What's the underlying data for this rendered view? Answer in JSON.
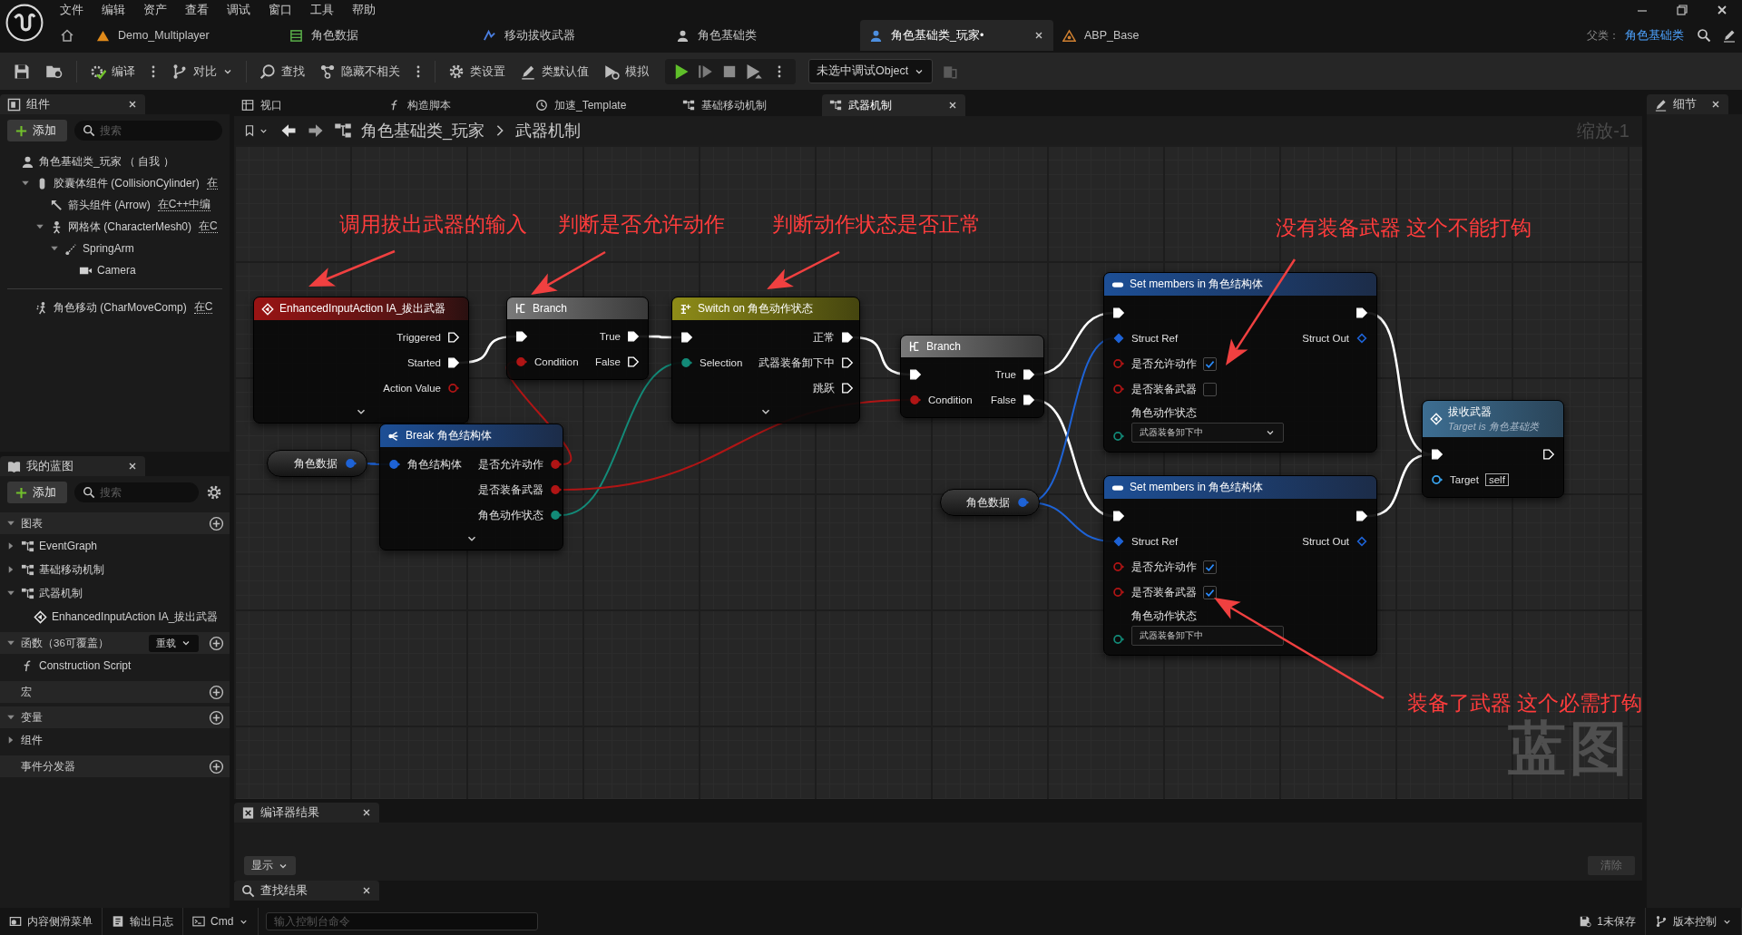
{
  "menu": [
    "文件",
    "编辑",
    "资产",
    "查看",
    "调试",
    "窗口",
    "工具",
    "帮助"
  ],
  "doc_tabs": [
    {
      "label": "Demo_Multiplayer",
      "selected": false
    },
    {
      "label": "角色数据",
      "selected": false
    },
    {
      "label": "移动拔收武器",
      "selected": false
    },
    {
      "label": "角色基础类",
      "selected": false
    },
    {
      "label": "角色基础类_玩家•",
      "selected": true
    },
    {
      "label": "ABP_Base",
      "selected": false
    }
  ],
  "parent_class": {
    "label": "父类：",
    "value": "角色基础类"
  },
  "toolbar": {
    "compile": "编译",
    "diff": "对比",
    "find": "查找",
    "hide_unrelated": "隐藏不相关",
    "class_settings": "类设置",
    "class_defaults": "类默认值",
    "simulate": "模拟",
    "debug_object": "未选中调试Object"
  },
  "components_panel": {
    "title": "组件",
    "add": "添加",
    "search_placeholder": "搜索",
    "tree": [
      {
        "label": "角色基础类_玩家 （ 自我 ）",
        "children": [
          {
            "label": "胶囊体组件 (CollisionCylinder)",
            "link": "在",
            "expanded": true,
            "children": [
              {
                "label": "箭头组件 (Arrow)",
                "link": "在C++中编"
              },
              {
                "label": "网格体 (CharacterMesh0)",
                "link": "在C",
                "expanded": true,
                "children": [
                  {
                    "label": "SpringArm",
                    "expanded": true,
                    "children": [
                      {
                        "label": "Camera"
                      }
                    ]
                  }
                ]
              }
            ]
          }
        ]
      }
    ],
    "movement": [
      {
        "label": "角色移动 (CharMoveComp)",
        "link": "在C"
      }
    ]
  },
  "my_blueprint": {
    "title": "我的蓝图",
    "add": "添加",
    "search_placeholder": "搜索",
    "sections": [
      {
        "label": "图表",
        "expanded": true,
        "items": [
          {
            "label": "EventGraph",
            "kind": "graph",
            "expanded": false
          },
          {
            "label": "基础移动机制",
            "kind": "graph",
            "expanded": false
          },
          {
            "label": "武器机制",
            "kind": "graph",
            "expanded": true,
            "children": [
              {
                "label": "EnhancedInputAction IA_拔出武器",
                "kind": "event"
              }
            ]
          }
        ]
      },
      {
        "label": "函数（36可覆盖）",
        "expanded": true,
        "override": "重载",
        "items": [
          {
            "label": "Construction Script",
            "kind": "function"
          }
        ]
      },
      {
        "label": "宏"
      },
      {
        "label": "变量",
        "expanded": true,
        "items": [
          {
            "label": "组件",
            "kind": "category",
            "expanded": false
          }
        ]
      },
      {
        "label": "事件分发器"
      }
    ]
  },
  "graph_tabs": [
    {
      "label": "视口",
      "selected": false
    },
    {
      "label": "构造脚本",
      "selected": false
    },
    {
      "label": "加速_Template",
      "selected": false
    },
    {
      "label": "基础移动机制",
      "selected": false
    },
    {
      "label": "武器机制",
      "selected": true
    }
  ],
  "breadcrumb": {
    "path": [
      "角色基础类_玩家",
      "武器机制"
    ],
    "zoom": "缩放-1"
  },
  "graph": {
    "annotations": [
      {
        "text": "调用拔出武器的输入"
      },
      {
        "text": "判断是否允许动作"
      },
      {
        "text": "判断动作状态是否正常"
      },
      {
        "text": "没有装备武器 这个不能打钩"
      },
      {
        "text": "装备了武器 这个必需打钩"
      }
    ],
    "nodes": [
      {
        "kind": "event",
        "title": "EnhancedInputAction IA_拔出武器",
        "outputs": [
          {
            "label": "Triggered",
            "kind": "exec",
            "connected": false
          },
          {
            "label": "Started",
            "kind": "exec",
            "connected": true
          },
          {
            "label": "Action Value",
            "kind": "bool",
            "connected": false
          }
        ],
        "expander": true
      },
      {
        "kind": "branch",
        "title": "Branch",
        "inputs": [
          {
            "kind": "exec",
            "connected": true
          },
          {
            "label": "Condition",
            "kind": "bool",
            "connected": true
          }
        ],
        "outputs": [
          {
            "label": "True",
            "kind": "exec",
            "connected": true
          },
          {
            "label": "False",
            "kind": "exec",
            "connected": false
          }
        ]
      },
      {
        "kind": "switch",
        "title": "Switch on 角色动作状态",
        "inputs": [
          {
            "kind": "exec",
            "connected": true
          },
          {
            "label": "Selection",
            "kind": "enum",
            "connected": true
          }
        ],
        "outputs": [
          {
            "label": "正常",
            "kind": "exec",
            "connected": true
          },
          {
            "label": "武器装备卸下中",
            "kind": "exec",
            "connected": false
          },
          {
            "label": "跳跃",
            "kind": "exec",
            "connected": false
          }
        ],
        "expander": true
      },
      {
        "kind": "branch",
        "title": "Branch",
        "inputs": [
          {
            "kind": "exec",
            "connected": true
          },
          {
            "label": "Condition",
            "kind": "bool",
            "connected": true
          }
        ],
        "outputs": [
          {
            "label": "True",
            "kind": "exec",
            "connected": true
          },
          {
            "label": "False",
            "kind": "exec",
            "connected": true
          }
        ]
      },
      {
        "kind": "set",
        "title": "Set members in 角色结构体",
        "inputs": [
          {
            "kind": "exec",
            "connected": true
          },
          {
            "label": "Struct Ref",
            "kind": "struct_ref",
            "connected": true
          },
          {
            "label": "是否允许动作",
            "kind": "bool",
            "connected": false,
            "checked": true
          },
          {
            "label": "是否装备武器",
            "kind": "bool",
            "connected": false,
            "checked": false
          },
          {
            "label": "角色动作状态",
            "kind": "enum",
            "connected": false,
            "value": "武器装备卸下中",
            "chevron": true
          }
        ],
        "outputs": [
          {
            "kind": "exec",
            "connected": true
          },
          {
            "label": "Struct Out",
            "kind": "struct_ref",
            "connected": false
          }
        ]
      },
      {
        "kind": "set",
        "title": "Set members in 角色结构体",
        "inputs": [
          {
            "kind": "exec",
            "connected": true
          },
          {
            "label": "Struct Ref",
            "kind": "struct_ref",
            "connected": true
          },
          {
            "label": "是否允许动作",
            "kind": "bool",
            "connected": false,
            "checked": true
          },
          {
            "label": "是否装备武器",
            "kind": "bool",
            "connected": false,
            "checked": true
          },
          {
            "label": "角色动作状态",
            "kind": "enum",
            "connected": false,
            "value": "武器装备卸下中",
            "chevron": false
          }
        ],
        "outputs": [
          {
            "kind": "exec",
            "connected": true
          },
          {
            "label": "Struct Out",
            "kind": "struct_ref",
            "connected": false
          }
        ]
      },
      {
        "kind": "call",
        "title": "拔收武器",
        "subtitle": "Target is 角色基础类",
        "inputs": [
          {
            "kind": "exec",
            "connected": true
          },
          {
            "label": "Target",
            "kind": "object",
            "connected": false,
            "value": "self"
          }
        ],
        "outputs": [
          {
            "kind": "exec",
            "connected": false
          }
        ]
      },
      {
        "kind": "break",
        "title": "Break 角色结构体",
        "inputs": [
          {
            "label": "角色结构体",
            "kind": "struct",
            "connected": true
          }
        ],
        "outputs": [
          {
            "label": "是否允许动作",
            "kind": "bool",
            "connected": true
          },
          {
            "label": "是否装备武器",
            "kind": "bool",
            "connected": true
          },
          {
            "label": "角色动作状态",
            "kind": "enum",
            "connected": true
          }
        ],
        "expander": true
      },
      {
        "kind": "variable",
        "title": "角色数据",
        "outputs": [
          {
            "kind": "struct",
            "connected": true
          }
        ]
      },
      {
        "kind": "variable",
        "title": "角色数据",
        "outputs": [
          {
            "kind": "struct",
            "connected": true
          }
        ]
      }
    ],
    "watermark": "蓝图"
  },
  "bottom": {
    "compiler_tab": "编译器结果",
    "show": "显示",
    "clear": {
      "label": "清除",
      "disabled": true
    },
    "find_tab": "查找结果"
  },
  "details_panel": {
    "title": "细节"
  },
  "status_bar": {
    "content_drawer": "内容侧滑菜单",
    "output_log": "输出日志",
    "cmd": "Cmd",
    "console_placeholder": "输入控制台命令",
    "unsaved": "1未保存",
    "source_control": "版本控制"
  }
}
